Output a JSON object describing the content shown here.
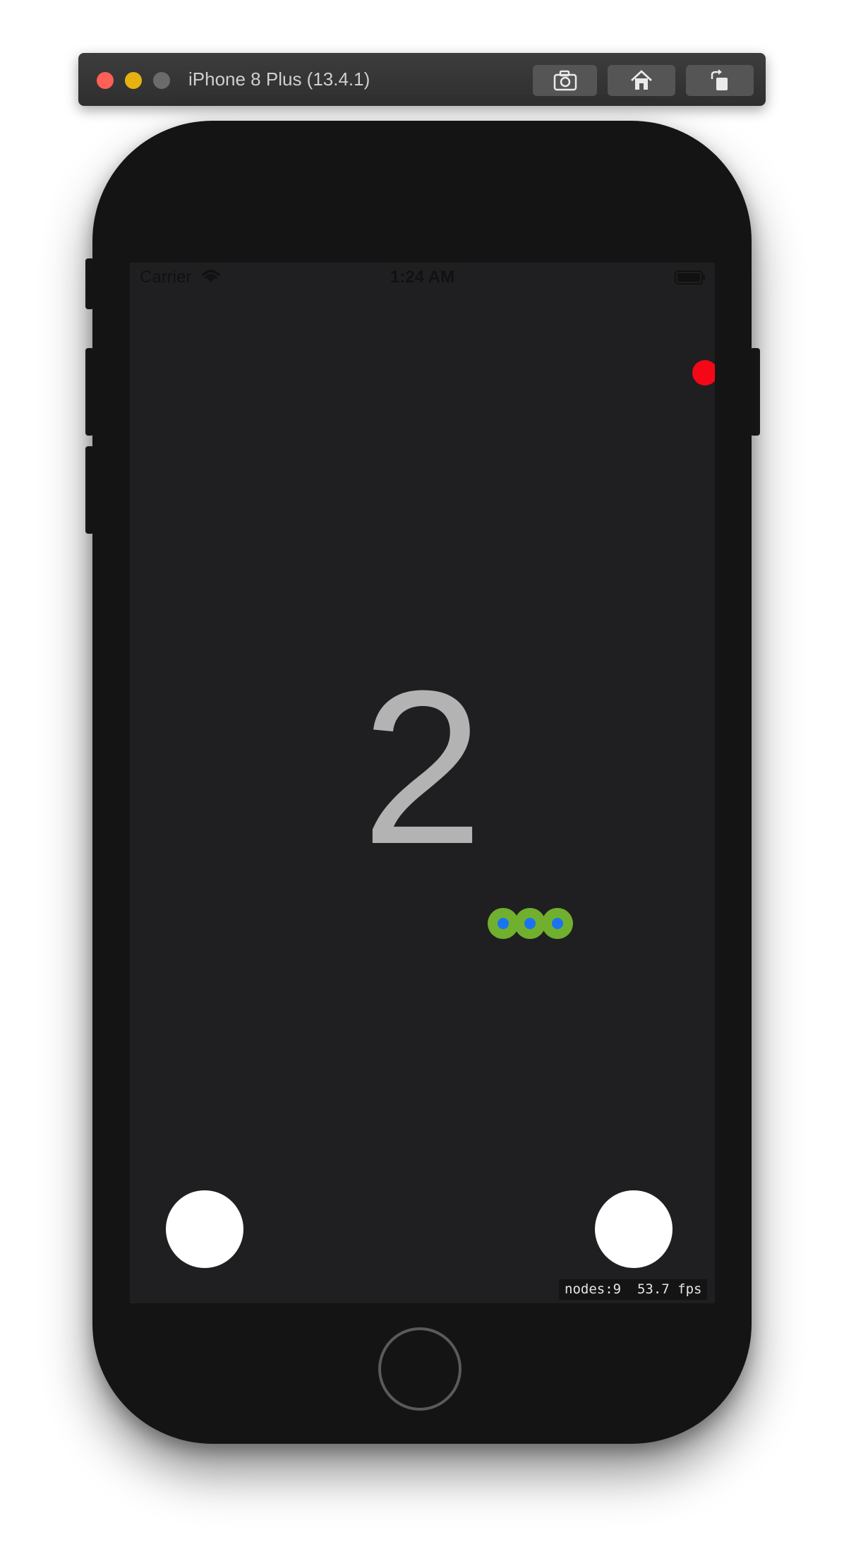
{
  "window": {
    "title": "iPhone 8 Plus (13.4.1)",
    "buttons": {
      "screenshot_icon": "camera-icon",
      "home_icon": "home-icon",
      "rotate_icon": "rotate-icon"
    }
  },
  "status_bar": {
    "carrier": "Carrier",
    "time": "1:24 AM",
    "wifi_icon": "wifi-icon",
    "battery_icon": "battery-icon"
  },
  "game": {
    "score": "2",
    "food_color": "#f40818",
    "snake_color": "#70b02e",
    "snake_eye_color": "#1a73f0",
    "snake_segments": 3
  },
  "debug": {
    "text": "nodes:9  53.7 fps"
  },
  "colors": {
    "screen_bg": "#1f1f21",
    "phone_body": "#141414",
    "score_text": "#b3b3b3"
  }
}
